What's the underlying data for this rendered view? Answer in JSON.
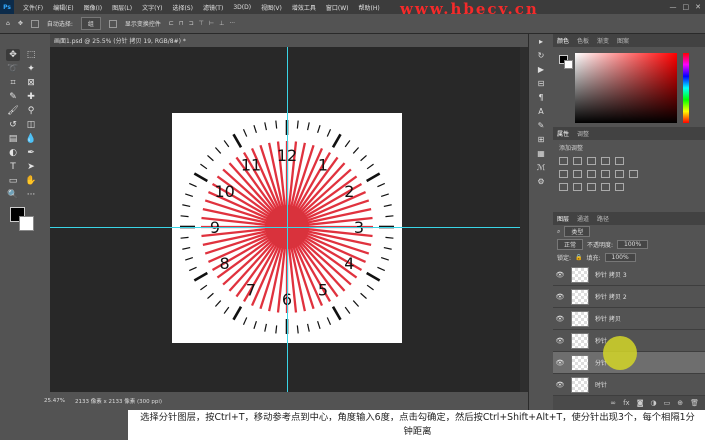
{
  "menubar": {
    "logo": "Ps",
    "items": [
      "文件(F)",
      "编辑(E)",
      "图像(I)",
      "图层(L)",
      "文字(Y)",
      "选择(S)",
      "滤镜(T)",
      "3D(D)",
      "视图(V)",
      "增效工具",
      "窗口(W)",
      "帮助(H)"
    ],
    "watermark": "www.hbecy.cn"
  },
  "optbar": {
    "auto_select": "自动选择:",
    "select_value": "组",
    "show_transform": "显示变换控件"
  },
  "document": {
    "tab_label": "画面1.psd @ 25.5% (分针 拷贝 19, RGB/8#) *",
    "status_zoom": "25.47%",
    "status_doc": "2133 像素 x 2133 像素 (300 ppi)"
  },
  "clock": {
    "numbers": [
      "12",
      "1",
      "2",
      "3",
      "4",
      "5",
      "6",
      "7",
      "8",
      "9",
      "10",
      "11"
    ],
    "ray_count": 60,
    "colors": {
      "ray": "#e0323e",
      "center": "#d9323c",
      "tick": "#111111"
    }
  },
  "panels": {
    "color_tabs": [
      "颜色",
      "色板",
      "渐变",
      "图案"
    ],
    "adjust_tabs": [
      "属性",
      "调整"
    ],
    "adjust_title": "添加调整",
    "layers_tabs": [
      "图层",
      "通道",
      "路径"
    ],
    "kind_filter": "类型",
    "blend_mode": "正常",
    "opacity_label": "不透明度:",
    "opacity_value": "100%",
    "lock_label": "锁定:",
    "fill_label": "填充:",
    "fill_value": "100%",
    "layers": [
      {
        "name": "秒针 拷贝 3"
      },
      {
        "name": "秒针 拷贝 2"
      },
      {
        "name": "秒针 拷贝"
      },
      {
        "name": "秒针"
      },
      {
        "name": "分针"
      },
      {
        "name": "时针"
      }
    ]
  },
  "subtitle": {
    "text": "选择分针图层，按Ctrl+T，移动参考点到中心，角度输入6度，点击勾确定，然后按Ctrl+Shift+Alt+T，使分针出现3个，每个相隔1分钟距离"
  }
}
